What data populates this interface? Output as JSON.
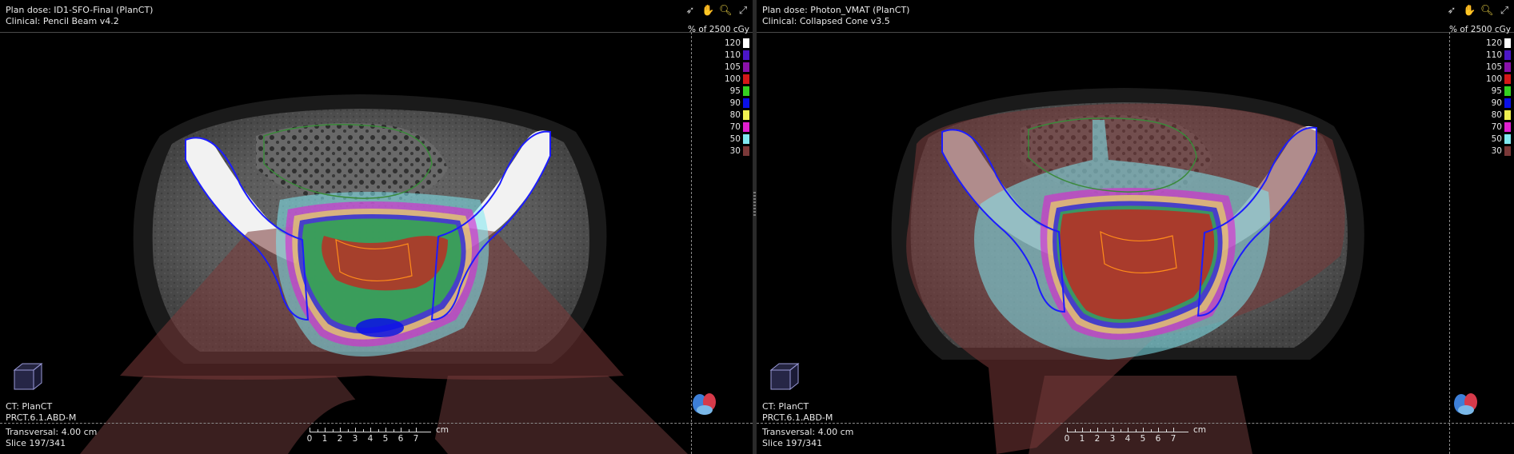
{
  "panes": [
    {
      "id": "left",
      "plan_dose": "Plan dose: ID1-SFO-Final (PlanCT)",
      "clinical": "Clinical: Pencil Beam v4.2",
      "legend_title": "% of 2500 cGy",
      "ct": "CT: PlanCT",
      "series": "PRCT.6.1.ABD-M",
      "orientation": "Transversal: 4.00 cm",
      "slice": "Slice 197/341"
    },
    {
      "id": "right",
      "plan_dose": "Plan dose: Photon_VMAT (PlanCT)",
      "clinical": "Clinical: Collapsed Cone v3.5",
      "legend_title": "% of 2500 cGy",
      "ct": "CT: PlanCT",
      "series": "PRCT.6.1.ABD-M",
      "orientation": "Transversal: 4.00 cm",
      "slice": "Slice 197/341"
    }
  ],
  "legend_levels": [
    {
      "label": "120",
      "color": "#ffffff"
    },
    {
      "label": "110",
      "color": "#4b16c8"
    },
    {
      "label": "105",
      "color": "#8a12a8"
    },
    {
      "label": "100",
      "color": "#d41818"
    },
    {
      "label": "95",
      "color": "#34d020"
    },
    {
      "label": "90",
      "color": "#0a10e8"
    },
    {
      "label": "80",
      "color": "#f0f050"
    },
    {
      "label": "70",
      "color": "#e020d0"
    },
    {
      "label": "50",
      "color": "#80e8f0"
    },
    {
      "label": "30",
      "color": "#7a3838"
    }
  ],
  "ruler": {
    "labels": [
      "0",
      "1",
      "2",
      "3",
      "4",
      "5",
      "6",
      "7"
    ],
    "unit": "cm"
  },
  "toolbar_icons": [
    "cursor-icon",
    "pan-hand-icon",
    "zoom-icon",
    "fit-view-icon"
  ]
}
